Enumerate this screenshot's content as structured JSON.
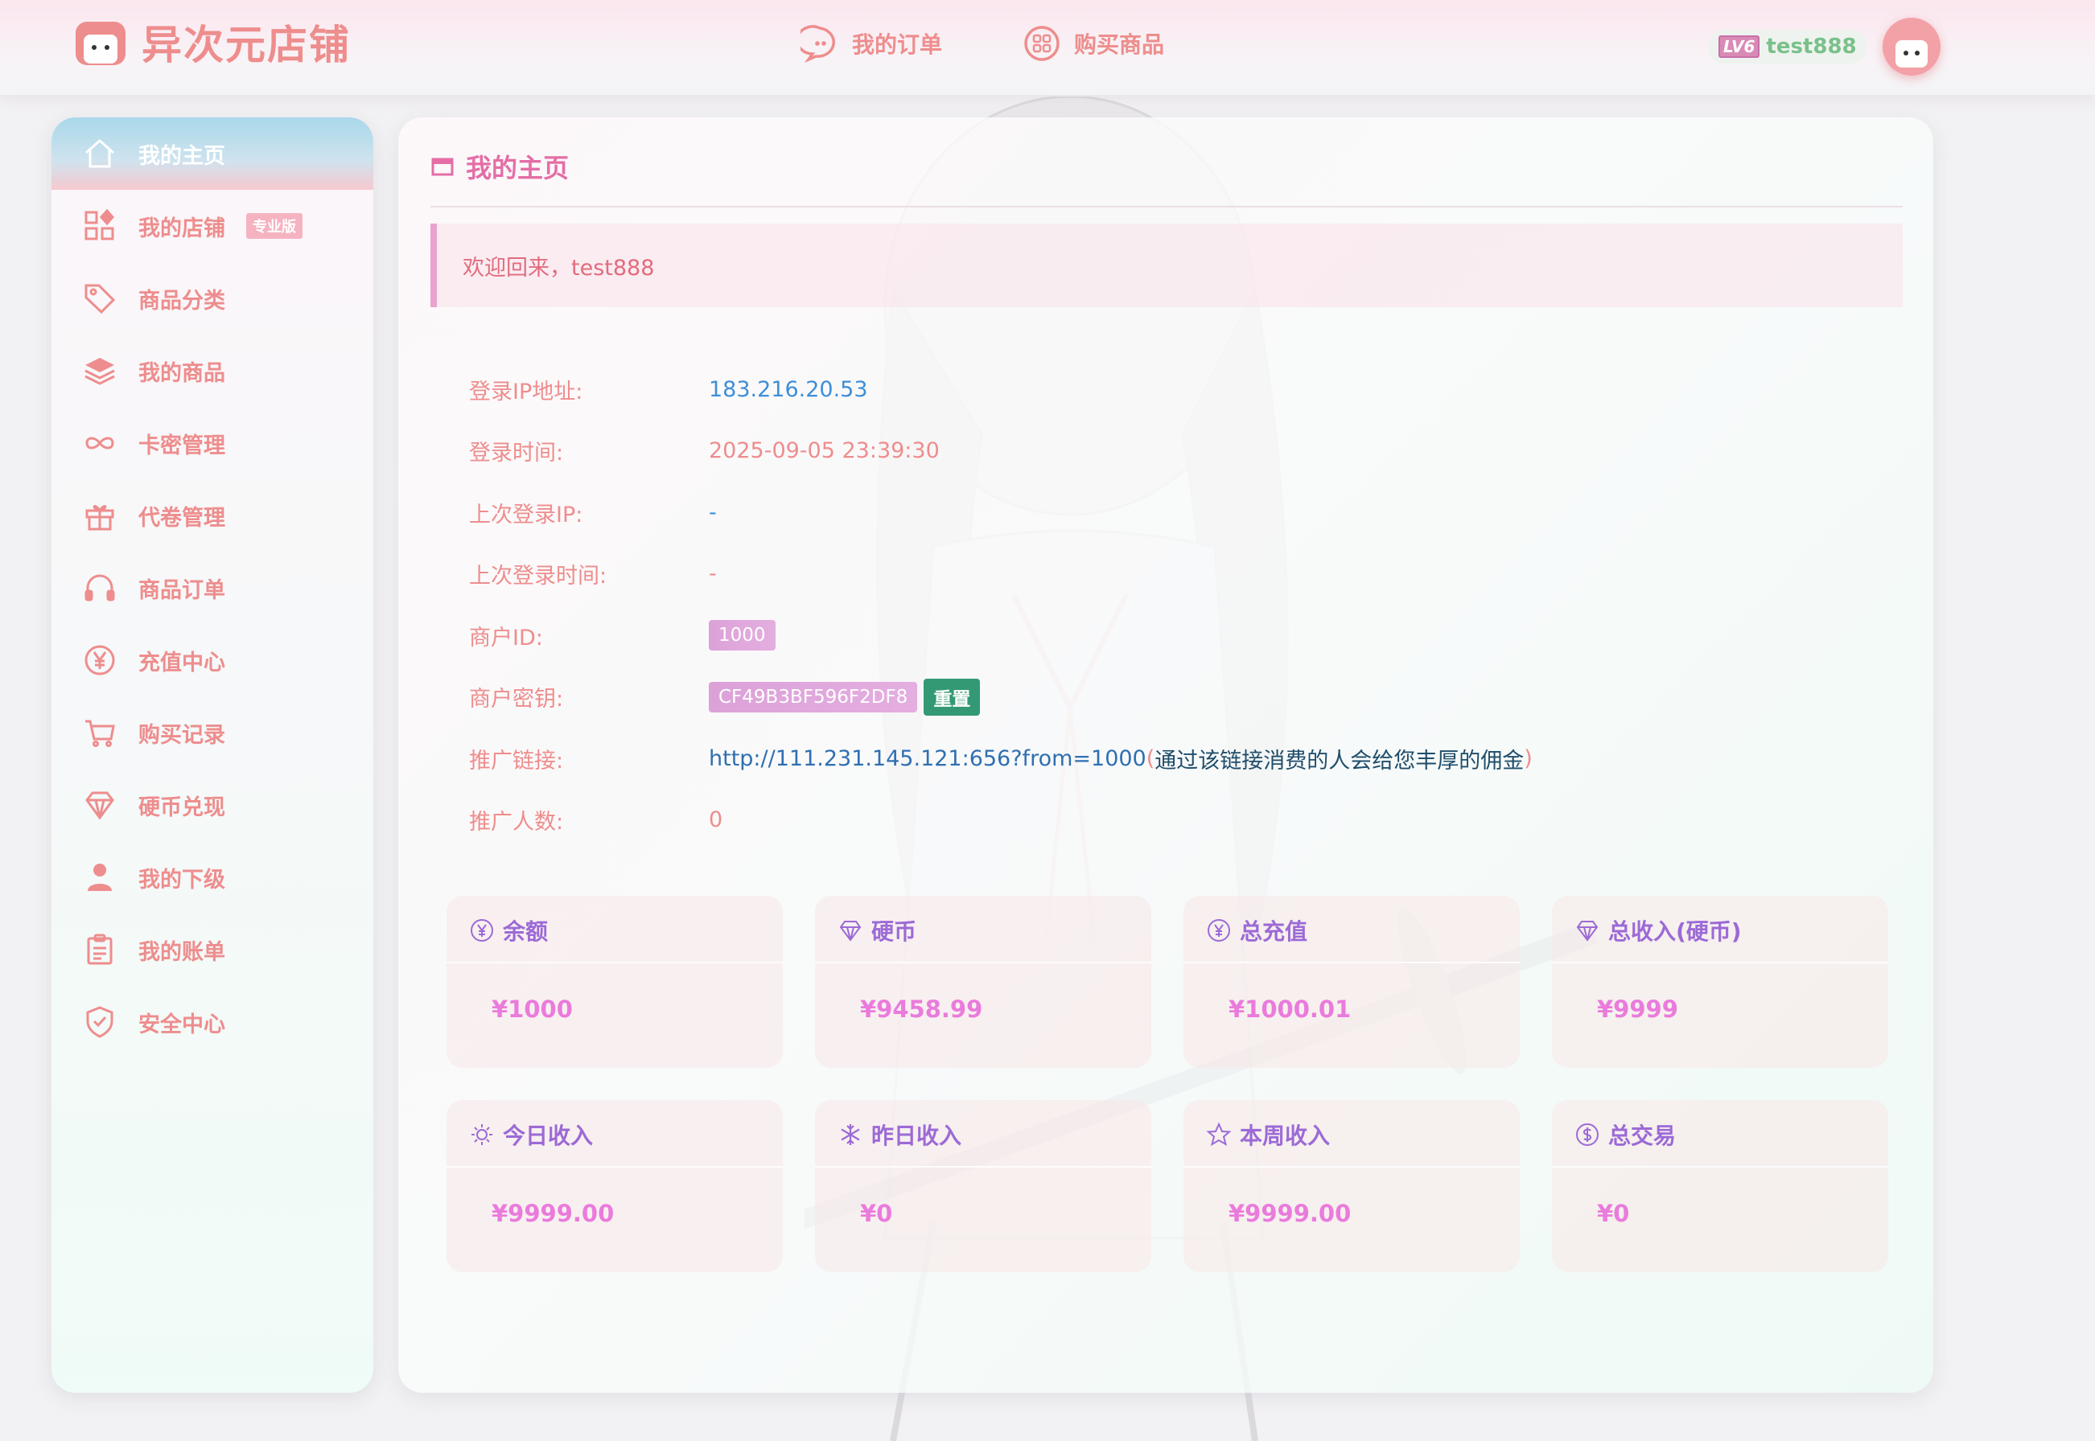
{
  "brand": {
    "name": "异次元店铺"
  },
  "topnav": [
    {
      "label": "我的订单",
      "icon": "chat-icon"
    },
    {
      "label": "购买商品",
      "icon": "apps-icon"
    }
  ],
  "user": {
    "level": "LV6",
    "name": "test888"
  },
  "sidebar": {
    "items": [
      {
        "label": "我的主页",
        "icon": "home-icon",
        "active": true
      },
      {
        "label": "我的店铺",
        "icon": "grid-icon",
        "badge": "专业版"
      },
      {
        "label": "商品分类",
        "icon": "tag-icon"
      },
      {
        "label": "我的商品",
        "icon": "layers-icon"
      },
      {
        "label": "卡密管理",
        "icon": "infinity-icon"
      },
      {
        "label": "代卷管理",
        "icon": "gift-icon"
      },
      {
        "label": "商品订单",
        "icon": "headphones-icon"
      },
      {
        "label": "充值中心",
        "icon": "yen-icon"
      },
      {
        "label": "购买记录",
        "icon": "cart-icon"
      },
      {
        "label": "硬币兑现",
        "icon": "diamond-icon"
      },
      {
        "label": "我的下级",
        "icon": "user-icon"
      },
      {
        "label": "我的账单",
        "icon": "clipboard-icon"
      },
      {
        "label": "安全中心",
        "icon": "shield-icon"
      }
    ]
  },
  "main": {
    "title": "我的主页",
    "welcome": "欢迎回来，test888",
    "info": {
      "login_ip_label": "登录IP地址:",
      "login_ip": "183.216.20.53",
      "login_time_label": "登录时间:",
      "login_time": "2025-09-05 23:39:30",
      "last_ip_label": "上次登录IP:",
      "last_ip": "-",
      "last_time_label": "上次登录时间:",
      "last_time": "-",
      "merchant_id_label": "商户ID:",
      "merchant_id": "1000",
      "merchant_key_label": "商户密钥:",
      "merchant_key": "CF49B3BF596F2DF8",
      "reset_label": "重置",
      "promo_link_label": "推广链接:",
      "promo_link": "http://111.231.145.121:656?from=1000",
      "promo_paren_open": "(",
      "promo_note": "通过该链接消费的人会给您丰厚的佣金",
      "promo_paren_close": ")",
      "promo_count_label": "推广人数:",
      "promo_count": "0"
    },
    "stats": [
      {
        "label": "余额",
        "value": "¥1000",
        "icon": "yen-circle-icon"
      },
      {
        "label": "硬币",
        "value": "¥9458.99",
        "icon": "diamond-icon"
      },
      {
        "label": "总充值",
        "value": "¥1000.01",
        "icon": "yen-circle-icon"
      },
      {
        "label": "总收入(硬币)",
        "value": "¥9999",
        "icon": "diamond-icon"
      },
      {
        "label": "今日收入",
        "value": "¥9999.00",
        "icon": "sun-icon"
      },
      {
        "label": "昨日收入",
        "value": "¥0",
        "icon": "snowflake-icon"
      },
      {
        "label": "本周收入",
        "value": "¥9999.00",
        "icon": "star-icon"
      },
      {
        "label": "总交易",
        "value": "¥0",
        "icon": "dollar-circle-icon"
      }
    ]
  },
  "colors": {
    "accent_pink": "#ee8d8d",
    "title_pink": "#e46ea6",
    "stat_purple": "#9c6ad6",
    "stat_value": "#ea7bdc",
    "link_blue": "#3d8fd8",
    "reset_green": "#339974"
  }
}
